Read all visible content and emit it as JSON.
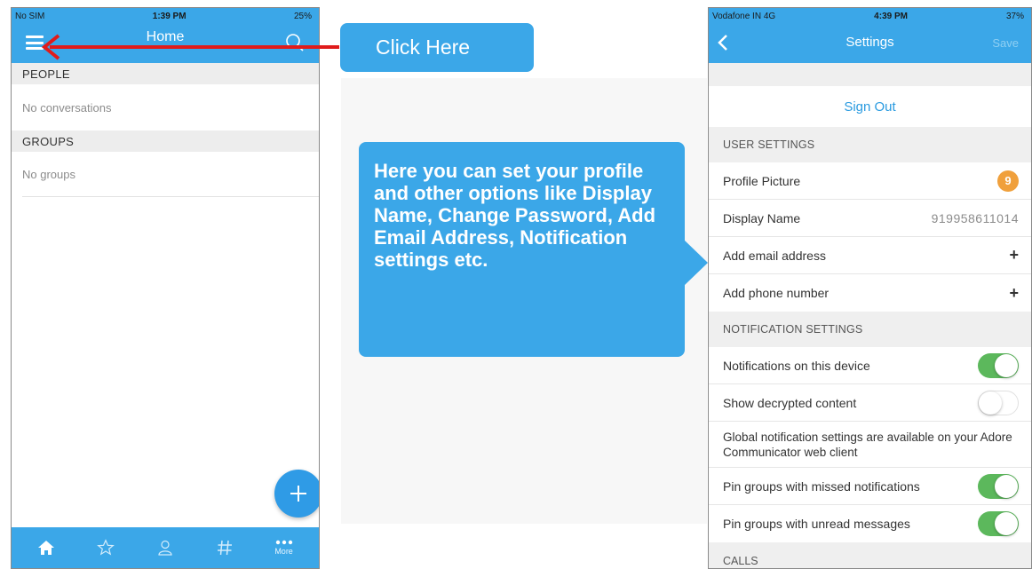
{
  "left_phone": {
    "status": {
      "carrier": "No SIM",
      "time": "1:39 PM",
      "battery": "25%"
    },
    "header": {
      "title": "Home",
      "menu_icon": "hamburger-menu-icon",
      "search_icon": "search-icon"
    },
    "sections": {
      "people_title": "PEOPLE",
      "people_empty": "No conversations",
      "groups_title": "GROUPS",
      "groups_empty": "No groups"
    },
    "fab_icon": "plus-icon",
    "tabbar": {
      "items": [
        "home-icon",
        "star-icon",
        "person-icon",
        "hashtag-icon",
        "more-icon"
      ],
      "more_label": "More"
    }
  },
  "callouts": {
    "click_here": "Click Here",
    "info": "Here you can set your profile and other options like Display Name, Change Password, Add Email Address, Notification settings etc."
  },
  "right_phone": {
    "status": {
      "carrier": "Vodafone IN 4G",
      "time": "4:39 PM",
      "battery": "37%"
    },
    "header": {
      "title": "Settings",
      "save_label": "Save",
      "back_icon": "chevron-left-icon"
    },
    "sign_out": "Sign Out",
    "user_settings": {
      "title": "USER SETTINGS",
      "profile_picture_label": "Profile Picture",
      "avatar_initial": "9",
      "display_name_label": "Display Name",
      "display_name_value": "919958611014",
      "add_email_label": "Add email address",
      "add_phone_label": "Add phone number",
      "plus": "+"
    },
    "notification_settings": {
      "title": "NOTIFICATION SETTINGS",
      "items": [
        {
          "label": "Notifications on this device",
          "state": "on"
        },
        {
          "label": "Show decrypted content",
          "state": "off"
        }
      ],
      "global_note": "Global notification settings are available on your Adore Communicator web client",
      "pin_items": [
        {
          "label": "Pin groups with missed notifications",
          "state": "on"
        },
        {
          "label": "Pin groups with unread messages",
          "state": "on"
        }
      ]
    },
    "calls_title": "CALLS"
  },
  "colors": {
    "brand_blue": "#3ba7e8",
    "toggle_green": "#5cb85c",
    "arrow_red": "#e01b1b",
    "avatar_orange": "#f0a03c"
  }
}
